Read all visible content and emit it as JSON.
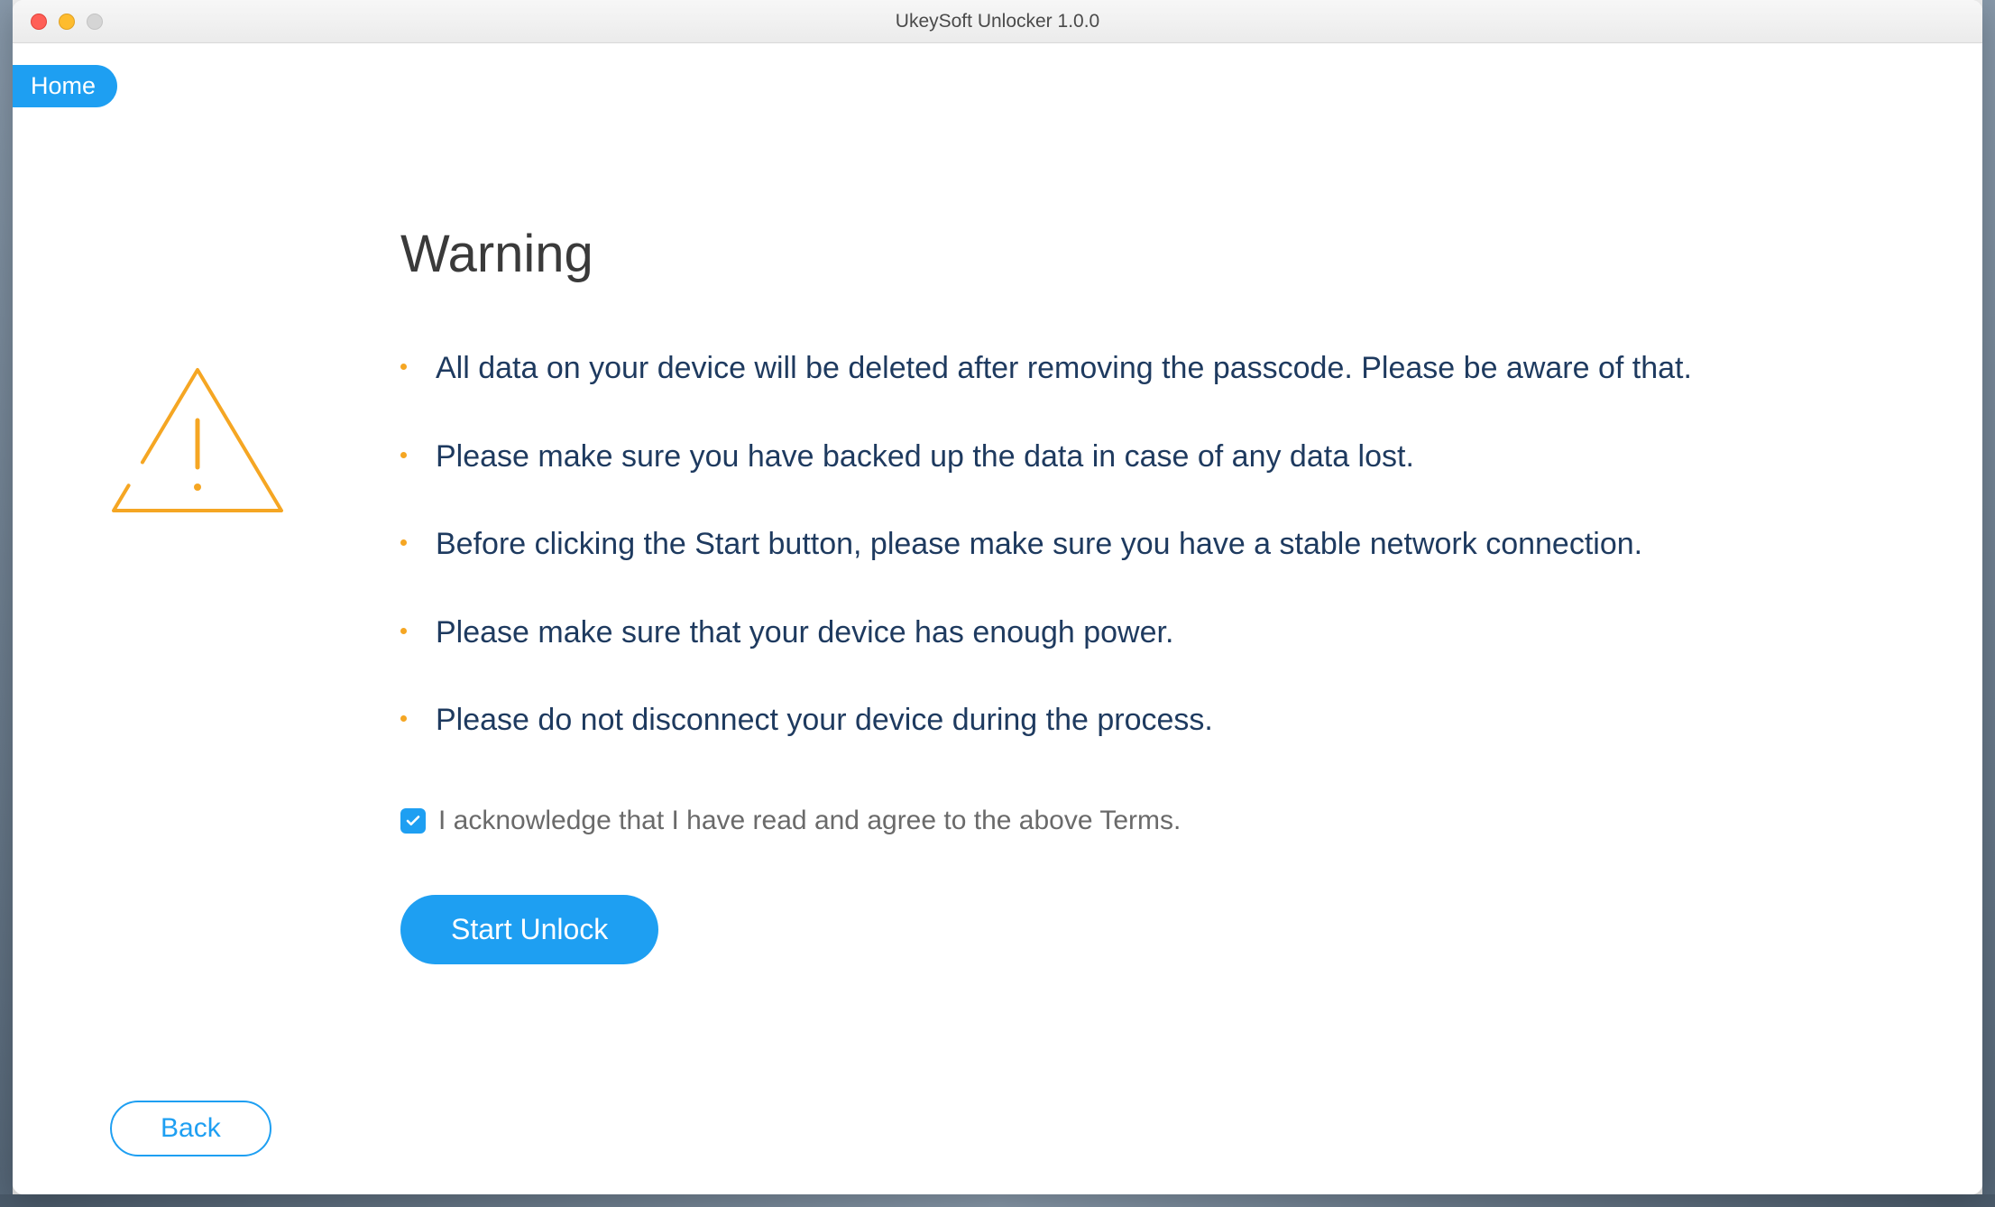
{
  "window": {
    "title": "UkeySoft Unlocker 1.0.0"
  },
  "nav": {
    "home_label": "Home"
  },
  "page": {
    "heading": "Warning",
    "bullets": [
      "All data on your device will be deleted after removing the passcode. Please be aware of that.",
      "Please make sure you have backed up the data in case of any data lost.",
      "Before clicking the Start button, please make sure you have a stable network connection.",
      "Please make sure that your device has enough power.",
      "Please do not disconnect your device during the process."
    ],
    "ack_label": "I acknowledge that I have read and agree to the above Terms.",
    "ack_checked": true
  },
  "buttons": {
    "start_label": "Start Unlock",
    "back_label": "Back"
  },
  "colors": {
    "accent": "#1e9ff2",
    "bullet": "#f5a623",
    "text_dark": "#1e3a5f"
  }
}
